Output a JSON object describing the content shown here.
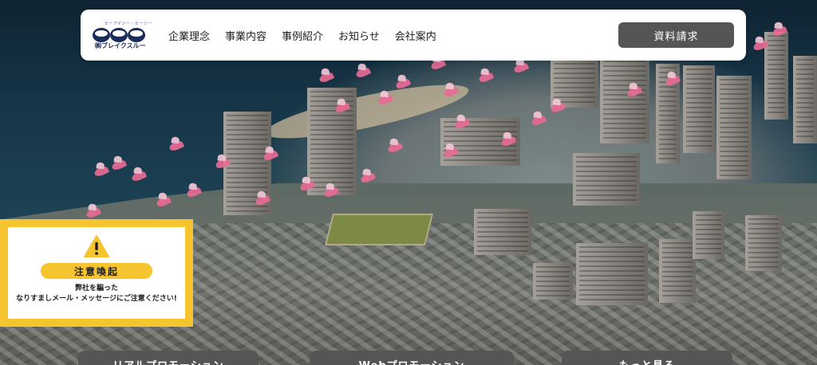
{
  "header": {
    "logo": {
      "tagline": "ビーアイシー・ビーシー",
      "name": "㈱ブレイクスルー"
    },
    "nav": [
      "企業理念",
      "事業内容",
      "事例紹介",
      "お知らせ",
      "会社案内"
    ],
    "cta_label": "資料請求"
  },
  "caution": {
    "title": "注意喚起",
    "line1": "弊社を騙った",
    "line2": "なりすましメール・メッセージにご注意ください!"
  },
  "bottom_tabs": [
    "リアルプロモーション",
    "Webプロモーション",
    "もっと見る"
  ],
  "colors": {
    "accent_yellow": "#f6c42f",
    "button_gray": "#555555",
    "logo_blue": "#1a2c5a"
  }
}
